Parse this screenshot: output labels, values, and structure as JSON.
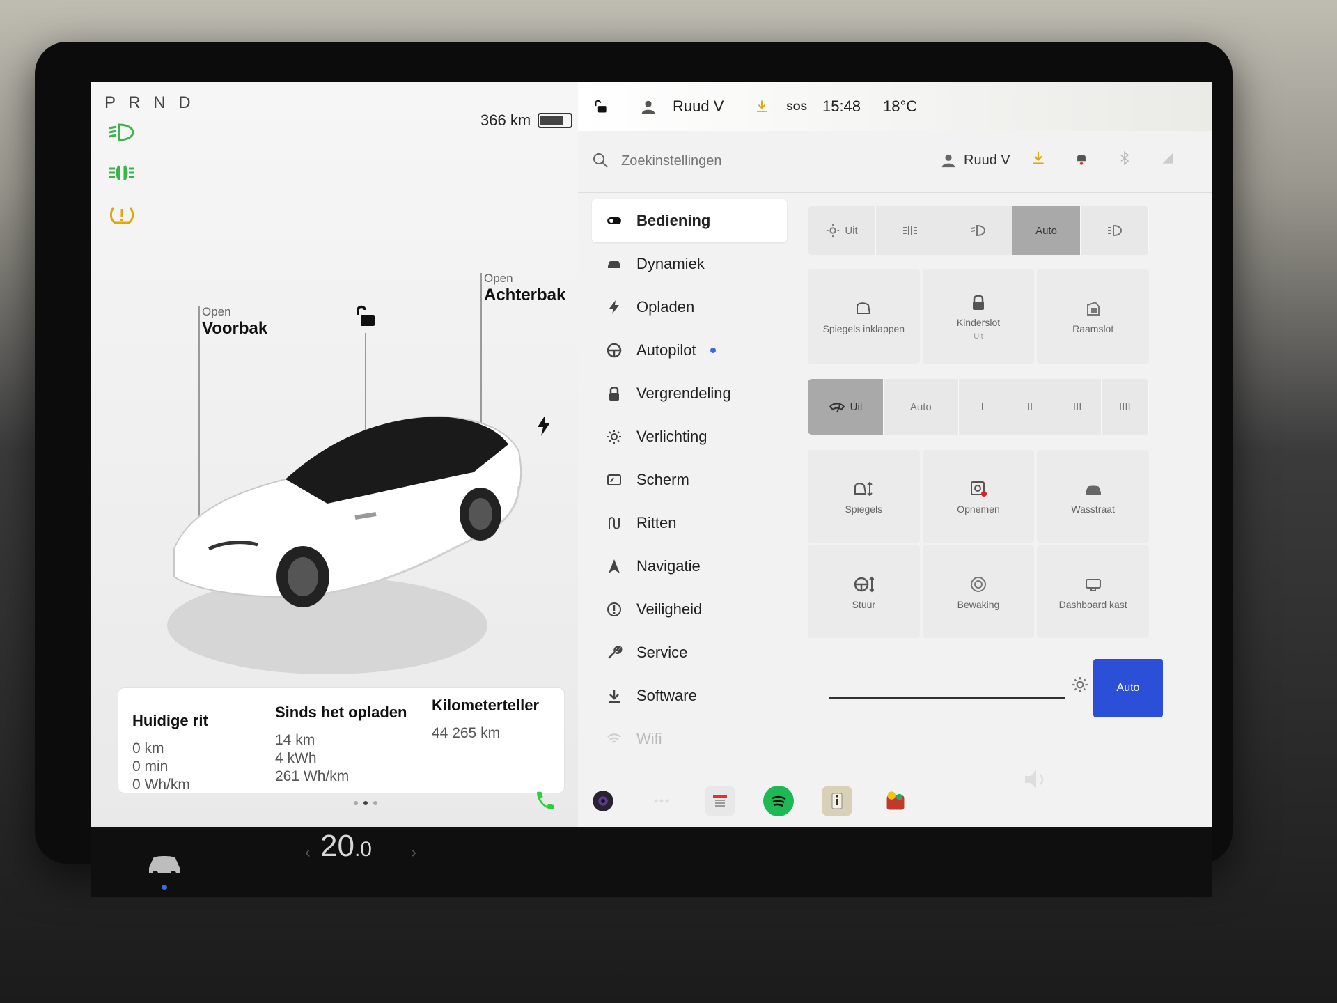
{
  "gear": {
    "p": "P",
    "r": "R",
    "n": "N",
    "d": "D"
  },
  "range": {
    "value": "366 km",
    "battery_level": 0.78
  },
  "callouts": {
    "frunk": {
      "status": "Open",
      "label": "Voorbak"
    },
    "trunk": {
      "status": "Open",
      "label": "Achterbak"
    }
  },
  "statusbar": {
    "user": "Ruud V",
    "sos": "SOS",
    "time": "15:48",
    "temperature": "18°C"
  },
  "search": {
    "placeholder": "Zoekinstellingen",
    "user": "Ruud V"
  },
  "menu": {
    "items": [
      {
        "label": "Bediening"
      },
      {
        "label": "Dynamiek"
      },
      {
        "label": "Opladen"
      },
      {
        "label": "Autopilot"
      },
      {
        "label": "Vergrendeling"
      },
      {
        "label": "Verlichting"
      },
      {
        "label": "Scherm"
      },
      {
        "label": "Ritten"
      },
      {
        "label": "Navigatie"
      },
      {
        "label": "Veiligheid"
      },
      {
        "label": "Service"
      },
      {
        "label": "Software"
      },
      {
        "label": "Wifi"
      }
    ]
  },
  "lights": {
    "off": "Uit",
    "auto": "Auto"
  },
  "quick_tiles": {
    "mirrors_fold": "Spiegels inklappen",
    "child_lock": "Kinderslot",
    "child_lock_state": "Uit",
    "window_lock": "Raamslot"
  },
  "wipers": {
    "off": "Uit",
    "auto": "Auto",
    "s1": "I",
    "s2": "II",
    "s3": "III",
    "s4": "IIII"
  },
  "adjust_tiles": {
    "mirrors": "Spiegels",
    "record": "Opnemen",
    "car_wash": "Wasstraat",
    "steering": "Stuur",
    "sentry": "Bewaking",
    "dashcam": "Dashboard kast"
  },
  "brightness": {
    "auto": "Auto"
  },
  "trip": {
    "current": {
      "title": "Huidige rit",
      "distance": "0 km",
      "duration": "0 min",
      "efficiency": "0 Wh/km"
    },
    "since_charge": {
      "title": "Sinds het opladen",
      "distance": "14 km",
      "energy": "4 kWh",
      "efficiency": "261 Wh/km"
    },
    "odometer": {
      "title": "Kilometerteller",
      "value": "44 265 km"
    }
  },
  "dock": {
    "temperature_int": "20",
    "temperature_dec": ".0"
  },
  "colors": {
    "accent": "#2b4fd6",
    "indicator_green": "#3cb44b",
    "warning_amber": "#e0a800",
    "spotify": "#1db954",
    "phone": "#2ecc40"
  }
}
